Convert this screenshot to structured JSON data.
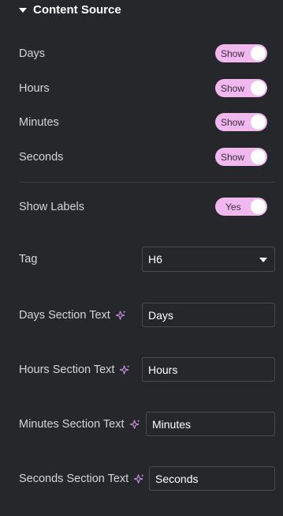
{
  "section": {
    "title": "Content Source"
  },
  "toggles": [
    {
      "label": "Days",
      "state": "Show"
    },
    {
      "label": "Hours",
      "state": "Show"
    },
    {
      "label": "Minutes",
      "state": "Show"
    },
    {
      "label": "Seconds",
      "state": "Show"
    }
  ],
  "show_labels": {
    "label": "Show Labels",
    "state": "Yes"
  },
  "tag": {
    "label": "Tag",
    "value": "H6"
  },
  "fields": [
    {
      "label": "Days Section Text",
      "value": "Days"
    },
    {
      "label": "Hours Section Text",
      "value": "Hours"
    },
    {
      "label": "Minutes Section Text",
      "value": "Minutes"
    },
    {
      "label": "Seconds Section Text",
      "value": "Seconds"
    }
  ],
  "colors": {
    "accent": "#f1b8f0",
    "ai_icon": "#c58ee0",
    "background": "#26272b"
  },
  "icons": {
    "section_caret": "caret-down-icon",
    "select_chevron": "chevron-down-icon",
    "ai": "sparkle-icon"
  }
}
